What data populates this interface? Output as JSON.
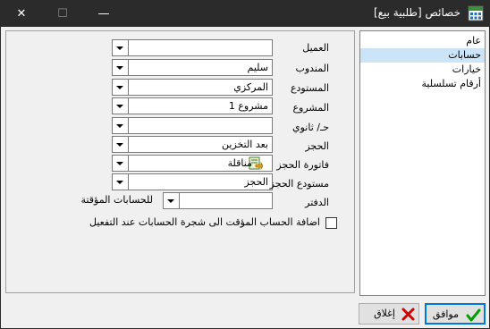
{
  "window": {
    "title": "خصائص [طلبية بيع]",
    "icon": "grid-app-icon",
    "controls": {
      "close": "✕",
      "maximize": "☐",
      "minimize": "—"
    }
  },
  "nav": {
    "items": [
      {
        "label": "عام",
        "selected": false
      },
      {
        "label": "حسابات",
        "selected": true
      },
      {
        "label": "خيارات",
        "selected": false
      },
      {
        "label": "أرقام تسلسلية",
        "selected": false
      }
    ]
  },
  "form": {
    "rows": [
      {
        "label": "العميل",
        "value": ""
      },
      {
        "label": "المندوب",
        "value": "سليم"
      },
      {
        "label": "المستودع",
        "value": "المركزي"
      },
      {
        "label": "المشروع",
        "value": "مشروع 1"
      },
      {
        "label": "حـ/ ثانوي",
        "value": ""
      },
      {
        "label": "الحجز",
        "value": "بعد التخزين"
      },
      {
        "label": "فاتورة الحجز",
        "value": "مناقلة",
        "icon": "transfer-doc-icon"
      },
      {
        "label": "مستودع الحجز",
        "value": "الحجز"
      }
    ],
    "ledger": {
      "label": "الدفتر",
      "value": "",
      "side_label": "للحسابات المؤقتة"
    },
    "checkbox": {
      "label": "اضافة الحساب المؤقت الى شجرة الحسابات عند التفعيل",
      "checked": false
    }
  },
  "buttons": {
    "ok": {
      "label": "موافق",
      "icon": "check-icon",
      "color": "#00a000"
    },
    "close": {
      "label": "إغلاق",
      "icon": "x-icon",
      "color": "#d00000"
    }
  },
  "colors": {
    "titlebar": "#2b2b2b",
    "selection": "#cce4f7",
    "accent": "#0078d7"
  }
}
